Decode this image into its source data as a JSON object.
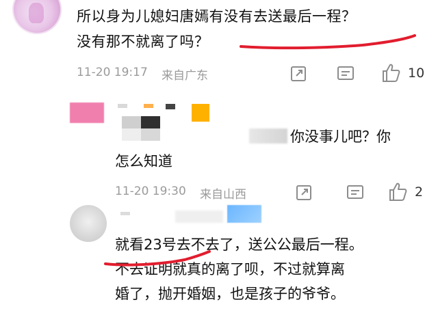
{
  "comment_main": {
    "text_line1": "所以身为儿媳妇唐嫣有没有去送最后一程？",
    "text_line2": "没有那不就离了吗？",
    "time": "11-20 19:17",
    "location": "来自广东",
    "like_count": "10",
    "accent_underline_color": "#e11d2e"
  },
  "reply_1": {
    "text_line1": "你没事儿吧？你",
    "text_line2": "怎么知道",
    "time": "11-20 19:30",
    "location": "来自山西",
    "like_count": "2"
  },
  "reply_2": {
    "text_line1": "就看23号去不去了，送公公最后一程。",
    "text_line2": "不去证明就真的离了呗，不过就算离",
    "text_line3": "婚了，抛开婚姻，也是孩子的爷爷。",
    "accent_underline_color": "#e11d2e"
  },
  "icons": {
    "share": "share-icon",
    "reply": "comment-icon",
    "like": "thumbs-up-icon"
  },
  "colors": {
    "meta_gray": "#9a9a9a",
    "text": "#111111"
  }
}
